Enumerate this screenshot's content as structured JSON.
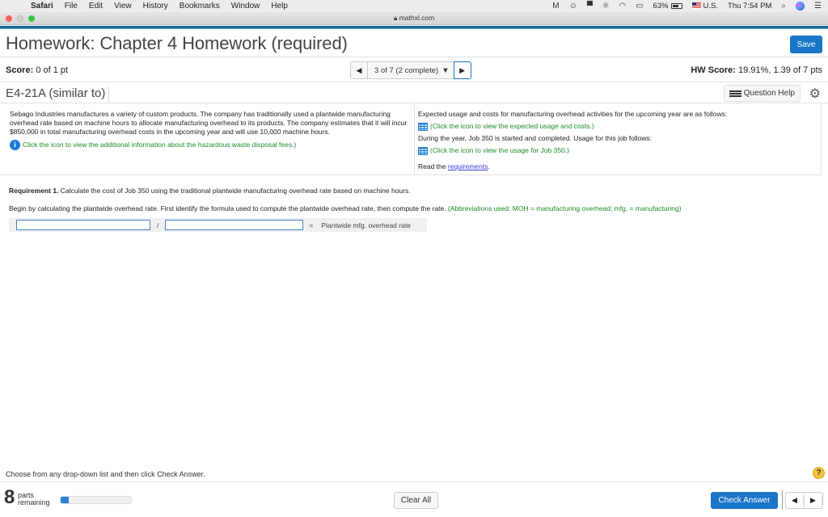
{
  "menubar": {
    "app": "Safari",
    "items": [
      "File",
      "Edit",
      "View",
      "History",
      "Bookmarks",
      "Window",
      "Help"
    ],
    "battery": "63%",
    "input_source": "U.S.",
    "clock": "Thu 7:54 PM"
  },
  "browser": {
    "url": "mathxl.com"
  },
  "header": {
    "title": "Homework: Chapter 4 Homework (required)",
    "save_label": "Save"
  },
  "score": {
    "label": "Score:",
    "value": "0 of 1 pt",
    "hw_label": "HW Score:",
    "hw_value": "19.91%, 1.39 of 7 pts"
  },
  "question_nav": {
    "selected": "3 of 7 (2 complete)"
  },
  "question": {
    "id": "E4-21A (similar to)",
    "help_label": "Question Help"
  },
  "problem": {
    "intro": "Sebago Industries manufactures a variety of custom products. The company has traditionally used a plantwide manufacturing overhead rate based on machine hours to allocate manufacturing overhead to its products. The company estimates that it will incur $850,000 in total manufacturing overhead costs in the upcoming year and will use 10,000 machine hours.",
    "info_link": "Click the icon to view the additional information about the hazardous waste disposal fees.)",
    "expected_text": "Expected usage and costs for manufacturing overhead activities for the upcoming year are as follows:",
    "expected_link": "(Click the icon to view the expected usage and costs.)",
    "job_text": "During the year, Job 350 is started and completed. Usage for this job follows:",
    "job_link": "(Click the icon to view the usage for Job 350.)",
    "read_prefix": "Read the ",
    "read_link": "requirements",
    "read_suffix": "."
  },
  "requirement": {
    "label": "Requirement 1.",
    "text": " Calculate the cost of Job 350 using the traditional plantwide manufacturing overhead rate based on machine hours.",
    "begin": "Begin by calculating the plantwide overhead rate. First identify the formula used to compute the plantwide overhead rate, then compute the rate. ",
    "abbrev": "(Abbreviations used: MOH = manufacturing overhead; mfg. = manufacturing)"
  },
  "formula": {
    "input1_value": "",
    "operator": "/",
    "input2_value": "",
    "equals": "=",
    "result_label": "Plantwide mfg. overhead rate"
  },
  "footer": {
    "instruction": "Choose from any drop-down list and then click Check Answer.",
    "parts_count": "8",
    "parts_label_1": "parts",
    "parts_label_2": "remaining",
    "progress_fraction": 0.11,
    "clear_label": "Clear All",
    "check_label": "Check Answer"
  },
  "colors": {
    "accent": "#1b75c9",
    "header_bar": "#0e6b92",
    "hint_green": "#1e8a2a",
    "help_yellow": "#f5c33b"
  }
}
